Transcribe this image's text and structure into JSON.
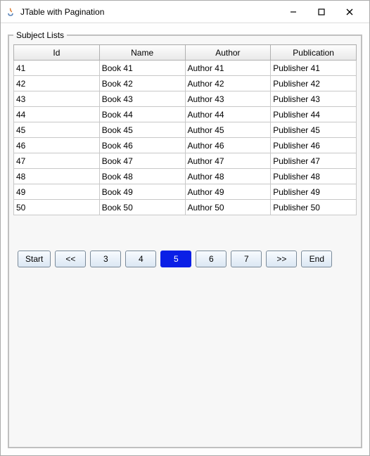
{
  "window": {
    "title": "JTable with Pagination"
  },
  "panel": {
    "legend": "Subject Lists"
  },
  "table": {
    "columns": [
      "Id",
      "Name",
      "Author",
      "Publication"
    ],
    "rows": [
      {
        "id": "41",
        "name": "Book 41",
        "author": "Author 41",
        "publication": "Publisher 41"
      },
      {
        "id": "42",
        "name": "Book 42",
        "author": "Author 42",
        "publication": "Publisher 42"
      },
      {
        "id": "43",
        "name": "Book 43",
        "author": "Author 43",
        "publication": "Publisher 43"
      },
      {
        "id": "44",
        "name": "Book 44",
        "author": "Author 44",
        "publication": "Publisher 44"
      },
      {
        "id": "45",
        "name": "Book 45",
        "author": "Author 45",
        "publication": "Publisher 45"
      },
      {
        "id": "46",
        "name": "Book 46",
        "author": "Author 46",
        "publication": "Publisher 46"
      },
      {
        "id": "47",
        "name": "Book 47",
        "author": "Author 47",
        "publication": "Publisher 47"
      },
      {
        "id": "48",
        "name": "Book 48",
        "author": "Author 48",
        "publication": "Publisher 48"
      },
      {
        "id": "49",
        "name": "Book 49",
        "author": "Author 49",
        "publication": "Publisher 49"
      },
      {
        "id": "50",
        "name": "Book 50",
        "author": "Author 50",
        "publication": "Publisher 50"
      }
    ]
  },
  "pager": {
    "start": "Start",
    "prev": "<<",
    "p1": "3",
    "p2": "4",
    "p3": "5",
    "p4": "6",
    "p5": "7",
    "next": ">>",
    "end": "End",
    "active_index": 2
  }
}
